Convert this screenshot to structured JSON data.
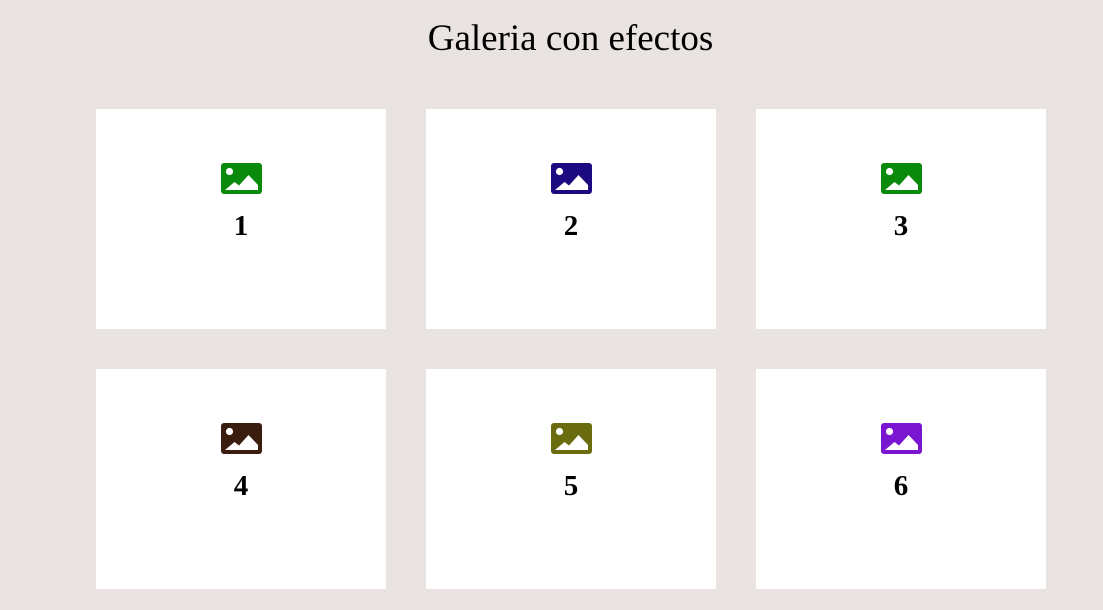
{
  "page": {
    "title": "Galeria con efectos"
  },
  "gallery": {
    "items": [
      {
        "label": "1",
        "icon": "image-icon",
        "color": "#0a8a0a"
      },
      {
        "label": "2",
        "icon": "image-icon",
        "color": "#1c0b80"
      },
      {
        "label": "3",
        "icon": "image-icon",
        "color": "#0a8a0a"
      },
      {
        "label": "4",
        "icon": "image-icon",
        "color": "#3a1d0f"
      },
      {
        "label": "5",
        "icon": "image-icon",
        "color": "#6b6b10"
      },
      {
        "label": "6",
        "icon": "image-icon",
        "color": "#7a16cf"
      }
    ]
  }
}
